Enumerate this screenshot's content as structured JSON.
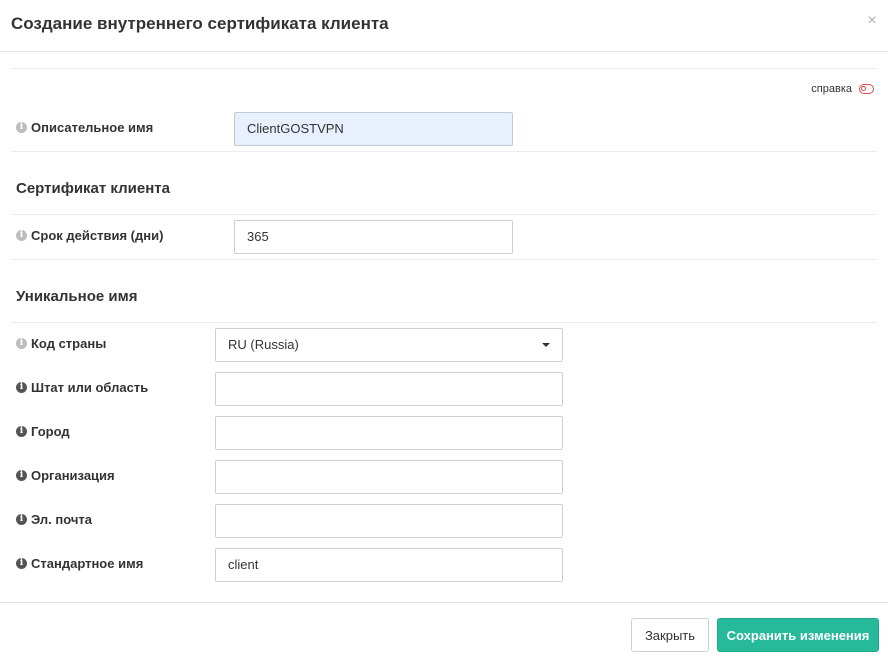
{
  "modal": {
    "title": "Создание внутреннего сертификата клиента",
    "close_glyph": "×"
  },
  "help": {
    "label": "справка",
    "toggle_on": false
  },
  "fields": {
    "description": {
      "label": "Описательное имя",
      "value": "ClientGOSTVPN"
    },
    "lifetime": {
      "label": "Срок действия (дни)",
      "value": "365"
    },
    "country": {
      "label": "Код страны",
      "value": "RU (Russia)"
    },
    "state": {
      "label": "Штат или область",
      "value": ""
    },
    "city": {
      "label": "Город",
      "value": ""
    },
    "organization": {
      "label": "Организация",
      "value": ""
    },
    "email": {
      "label": "Эл. почта",
      "value": ""
    },
    "common_name": {
      "label": "Стандартное имя",
      "value": "client"
    }
  },
  "sections": {
    "client_cert": "Сертификат клиента",
    "distinguished_name": "Уникальное имя"
  },
  "buttons": {
    "close": "Закрыть",
    "save": "Сохранить изменения"
  },
  "colors": {
    "primary": "#26b99a",
    "autofill_bg": "#e8f0fe",
    "toggle": "#e5484d"
  }
}
